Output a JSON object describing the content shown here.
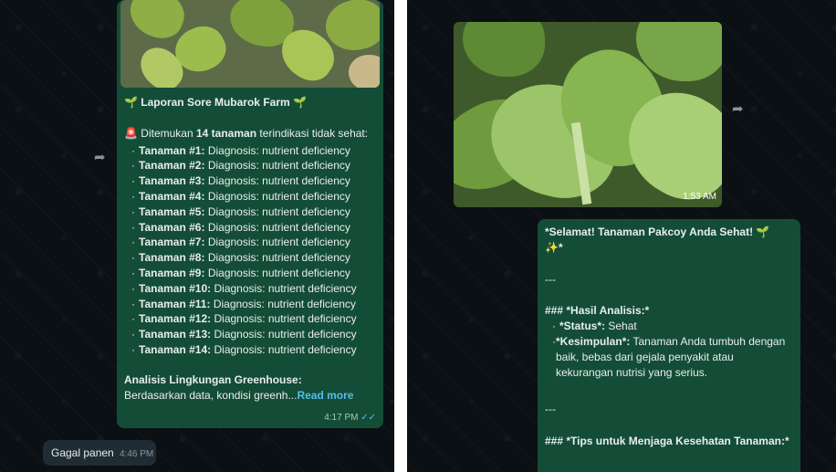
{
  "left_chat": {
    "report_title": "Laporan Sore Mubarok Farm",
    "sprout_icon": "🌱",
    "alert_icon": "🚨",
    "alert_prefix": "Ditemukan",
    "alert_count": "14 tanaman",
    "alert_suffix": "terindikasi tidak sehat:",
    "plants": [
      {
        "label": "Tanaman #1:",
        "diagnosis": "Diagnosis: nutrient deficiency"
      },
      {
        "label": "Tanaman #2:",
        "diagnosis": "Diagnosis: nutrient deficiency"
      },
      {
        "label": "Tanaman #3:",
        "diagnosis": "Diagnosis: nutrient deficiency"
      },
      {
        "label": "Tanaman #4:",
        "diagnosis": "Diagnosis: nutrient deficiency"
      },
      {
        "label": "Tanaman #5:",
        "diagnosis": "Diagnosis: nutrient deficiency"
      },
      {
        "label": "Tanaman #6:",
        "diagnosis": "Diagnosis: nutrient deficiency"
      },
      {
        "label": "Tanaman #7:",
        "diagnosis": "Diagnosis: nutrient deficiency"
      },
      {
        "label": "Tanaman #8:",
        "diagnosis": "Diagnosis: nutrient deficiency"
      },
      {
        "label": "Tanaman #9:",
        "diagnosis": "Diagnosis: nutrient deficiency"
      },
      {
        "label": "Tanaman #10:",
        "diagnosis": "Diagnosis: nutrient deficiency"
      },
      {
        "label": "Tanaman #11:",
        "diagnosis": "Diagnosis: nutrient deficiency"
      },
      {
        "label": "Tanaman #12:",
        "diagnosis": "Diagnosis: nutrient deficiency"
      },
      {
        "label": "Tanaman #13:",
        "diagnosis": "Diagnosis: nutrient deficiency"
      },
      {
        "label": "Tanaman #14:",
        "diagnosis": "Diagnosis: nutrient deficiency"
      }
    ],
    "env_heading": "Analisis Lingkungan Greenhouse:",
    "env_text": "Berdasarkan data, kondisi greenh...",
    "read_more": "Read more",
    "time": "4:17 PM",
    "incoming_text": "Gagal panen",
    "incoming_time": "4:46 PM"
  },
  "right_chat": {
    "photo_time": "1:53 AM",
    "line_title": "*Selamat! Tanaman Pakcoy Anda Sehat!",
    "line_title_end": "*",
    "sprout_icon": "🌱",
    "sparkle_icon": "✨",
    "separator1": "---",
    "hasil_heading": "### *Hasil Analisis:*",
    "status_label": "*Status*:",
    "status_value": "Sehat",
    "kesimpulan_label": "*Kesimpulan*:",
    "kesimpulan_value": "Tanaman Anda tumbuh dengan baik, bebas dari gejala penyakit atau kekurangan nutrisi yang serius.",
    "separator2": "---",
    "tips_heading": "### *Tips untuk Menjaga Kesehatan Tanaman:*"
  },
  "icons": {
    "forward": "forward-icon",
    "read_receipt": "double-check-icon"
  },
  "colors": {
    "outgoing_bubble": "#144d37",
    "incoming_bubble": "#202c33",
    "background": "#0b1014",
    "link": "#53bdeb"
  }
}
